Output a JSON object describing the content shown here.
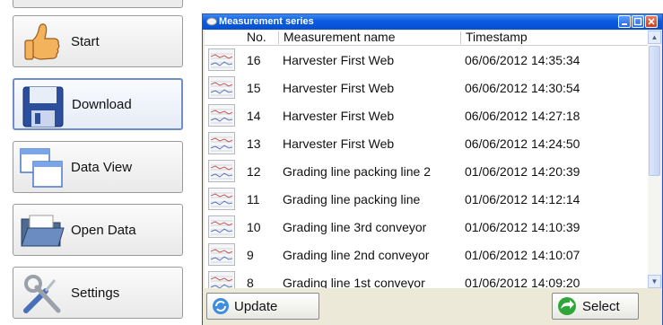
{
  "sidebar": {
    "items": [
      {
        "label": "Start",
        "icon": "thumbs-up-icon"
      },
      {
        "label": "Download",
        "icon": "floppy-disk-icon"
      },
      {
        "label": "Data View",
        "icon": "windows-icon"
      },
      {
        "label": "Open Data",
        "icon": "folder-icon"
      },
      {
        "label": "Settings",
        "icon": "tools-icon"
      }
    ]
  },
  "window": {
    "title": "Measurement series",
    "columns": {
      "no": "No.",
      "name": "Measurement name",
      "timestamp": "Timestamp"
    },
    "rows": [
      {
        "no": "16",
        "name": "Harvester First Web",
        "timestamp": "06/06/2012 14:35:34"
      },
      {
        "no": "15",
        "name": "Harvester First Web",
        "timestamp": "06/06/2012 14:30:54"
      },
      {
        "no": "14",
        "name": "Harvester First Web",
        "timestamp": "06/06/2012 14:27:18"
      },
      {
        "no": "13",
        "name": "Harvester First Web",
        "timestamp": "06/06/2012 14:24:50"
      },
      {
        "no": "12",
        "name": "Grading line packing line 2",
        "timestamp": "01/06/2012 14:20:39"
      },
      {
        "no": "11",
        "name": "Grading line packing line",
        "timestamp": "01/06/2012 14:12:14"
      },
      {
        "no": "10",
        "name": "Grading line 3rd conveyor",
        "timestamp": "01/06/2012 14:10:39"
      },
      {
        "no": "9",
        "name": "Grading line 2nd conveyor",
        "timestamp": "01/06/2012 14:10:07"
      },
      {
        "no": "8",
        "name": "Grading line 1st conveyor",
        "timestamp": "01/06/2012 14:09:20"
      }
    ],
    "buttons": {
      "update": "Update",
      "select": "Select"
    }
  },
  "colors": {
    "titlebar": "#0a5ae0",
    "accent": "#6f8fc4"
  }
}
